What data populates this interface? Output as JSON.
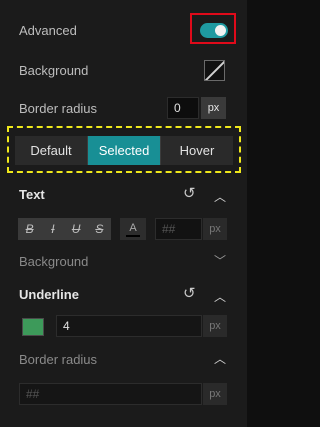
{
  "advanced": {
    "label": "Advanced",
    "enabled": true
  },
  "background": {
    "label": "Background"
  },
  "border_radius_top": {
    "label": "Border radius",
    "value": "0",
    "unit": "px"
  },
  "state_tabs": {
    "items": [
      "Default",
      "Selected",
      "Hover"
    ],
    "active": "Selected"
  },
  "text_section": {
    "title": "Text",
    "format_buttons": [
      "B",
      "I",
      "U",
      "S"
    ],
    "color_button": "A",
    "size_placeholder": "##",
    "size_unit": "px"
  },
  "background_section": {
    "label": "Background"
  },
  "underline_section": {
    "title": "Underline",
    "color": "#3d9a5a",
    "value": "4",
    "unit": "px"
  },
  "border_radius_section": {
    "title": "Border radius",
    "placeholder": "##",
    "unit": "px"
  },
  "colors": {
    "accent": "#188f95",
    "toggle": "#1f9aa1",
    "highlight_red": "#e00a1a",
    "highlight_yellow": "#f0e91b"
  }
}
